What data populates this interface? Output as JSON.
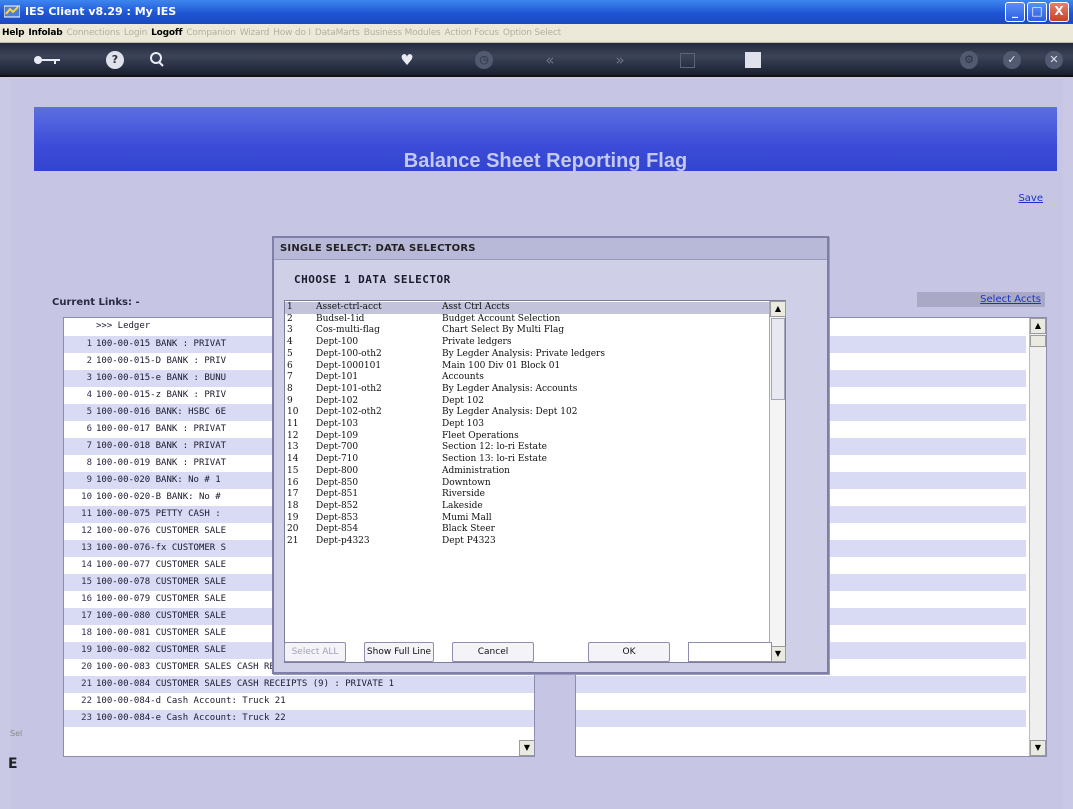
{
  "window": {
    "title": "IES Client v8.29 : My IES",
    "minimize": "_",
    "maximize": "□",
    "close": "X"
  },
  "menu": [
    {
      "label": "Help",
      "active": true
    },
    {
      "label": "Infolab",
      "active": true
    },
    {
      "label": "Connections",
      "active": false
    },
    {
      "label": "Login",
      "active": false
    },
    {
      "label": "Logoff",
      "active": true
    },
    {
      "label": "Companion",
      "active": false
    },
    {
      "label": "Wizard",
      "active": false
    },
    {
      "label": "How do I",
      "active": false
    },
    {
      "label": "DataMarts",
      "active": false
    },
    {
      "label": "Business Modules",
      "active": false
    },
    {
      "label": "Action Focus",
      "active": false
    },
    {
      "label": "Option Select",
      "active": false
    }
  ],
  "toolbar": {
    "icons": [
      "key-icon",
      "help-icon",
      "search-icon",
      "heart-icon",
      "history-icon",
      "rewind-icon",
      "forward-icon",
      "column-icon",
      "stop-icon",
      "settings-icon",
      "check-icon",
      "close-icon"
    ]
  },
  "page": {
    "title": "Balance Sheet Reporting Flag",
    "save_label": "Save",
    "select_accts_label": "Select Accts",
    "current_links_label": "Current Links: -"
  },
  "ledger": {
    "header": ">>> Ledger",
    "rows": [
      {
        "n": "1",
        "t": "100-00-015 BANK : PRIVAT"
      },
      {
        "n": "2",
        "t": "100-00-015-D BANK : PRIV"
      },
      {
        "n": "3",
        "t": "100-00-015-e BANK : BUNU"
      },
      {
        "n": "4",
        "t": "100-00-015-z BANK : PRIV"
      },
      {
        "n": "5",
        "t": "100-00-016 BANK: HSBC 6E"
      },
      {
        "n": "6",
        "t": "100-00-017 BANK : PRIVAT"
      },
      {
        "n": "7",
        "t": "100-00-018 BANK : PRIVAT"
      },
      {
        "n": "8",
        "t": "100-00-019 BANK : PRIVAT"
      },
      {
        "n": "9",
        "t": "100-00-020 BANK: No # 1"
      },
      {
        "n": "10",
        "t": "100-00-020-B BANK: No #"
      },
      {
        "n": "11",
        "t": "100-00-075 PETTY CASH :"
      },
      {
        "n": "12",
        "t": "100-00-076 CUSTOMER SALE"
      },
      {
        "n": "13",
        "t": "100-00-076-fx CUSTOMER S"
      },
      {
        "n": "14",
        "t": "100-00-077 CUSTOMER SALE"
      },
      {
        "n": "15",
        "t": "100-00-078 CUSTOMER SALE"
      },
      {
        "n": "16",
        "t": "100-00-079 CUSTOMER SALE"
      },
      {
        "n": "17",
        "t": "100-00-080 CUSTOMER SALE"
      },
      {
        "n": "18",
        "t": "100-00-081 CUSTOMER SALE"
      },
      {
        "n": "19",
        "t": "100-00-082 CUSTOMER SALE"
      },
      {
        "n": "20",
        "t": "100-00-083 CUSTOMER SALES CASH RECEIPTS (8) : PRIVATE 1"
      },
      {
        "n": "21",
        "t": "100-00-084 CUSTOMER SALES CASH RECEIPTS (9) : PRIVATE 1"
      },
      {
        "n": "22",
        "t": "100-00-084-d Cash Account: Truck 21"
      },
      {
        "n": "23",
        "t": "100-00-084-e Cash Account: Truck 22"
      }
    ]
  },
  "dialog": {
    "title": "SINGLE SELECT: DATA SELECTORS",
    "heading": "CHOOSE 1 DATA SELECTOR",
    "items": [
      {
        "n": "1",
        "code": "Asset-ctrl-acct",
        "desc": "Asst Ctrl Accts",
        "selected": true
      },
      {
        "n": "2",
        "code": "Budsel-1id",
        "desc": "Budget Account Selection"
      },
      {
        "n": "3",
        "code": "Cos-multi-flag",
        "desc": "Chart Select By Multi Flag"
      },
      {
        "n": "4",
        "code": "Dept-100",
        "desc": "Private ledgers"
      },
      {
        "n": "5",
        "code": "Dept-100-oth2",
        "desc": "By Legder Analysis: Private ledgers"
      },
      {
        "n": "6",
        "code": "Dept-1000101",
        "desc": "Main 100 Div 01 Block 01"
      },
      {
        "n": "7",
        "code": "Dept-101",
        "desc": "Accounts"
      },
      {
        "n": "8",
        "code": "Dept-101-oth2",
        "desc": "By Legder Analysis: Accounts"
      },
      {
        "n": "9",
        "code": "Dept-102",
        "desc": "Dept 102"
      },
      {
        "n": "10",
        "code": "Dept-102-oth2",
        "desc": "By Legder Analysis: Dept 102"
      },
      {
        "n": "11",
        "code": "Dept-103",
        "desc": "Dept 103"
      },
      {
        "n": "12",
        "code": "Dept-109",
        "desc": "Fleet Operations"
      },
      {
        "n": "13",
        "code": "Dept-700",
        "desc": "Section 12: lo-ri Estate"
      },
      {
        "n": "14",
        "code": "Dept-710",
        "desc": "Section 13: lo-ri Estate"
      },
      {
        "n": "15",
        "code": "Dept-800",
        "desc": "Administration"
      },
      {
        "n": "16",
        "code": "Dept-850",
        "desc": "Downtown"
      },
      {
        "n": "17",
        "code": "Dept-851",
        "desc": "Riverside"
      },
      {
        "n": "18",
        "code": "Dept-852",
        "desc": "Lakeside"
      },
      {
        "n": "19",
        "code": "Dept-853",
        "desc": "Mumi Mall"
      },
      {
        "n": "20",
        "code": "Dept-854",
        "desc": "Black Steer"
      },
      {
        "n": "21",
        "code": "Dept-p4323",
        "desc": "Dept P4323"
      }
    ],
    "buttons": {
      "select_all": "Select ALL",
      "show_full_line": "Show Full Line",
      "cancel": "Cancel",
      "ok": "OK"
    },
    "input_value": ""
  },
  "side_text": "Sel",
  "side_glyph": "E"
}
